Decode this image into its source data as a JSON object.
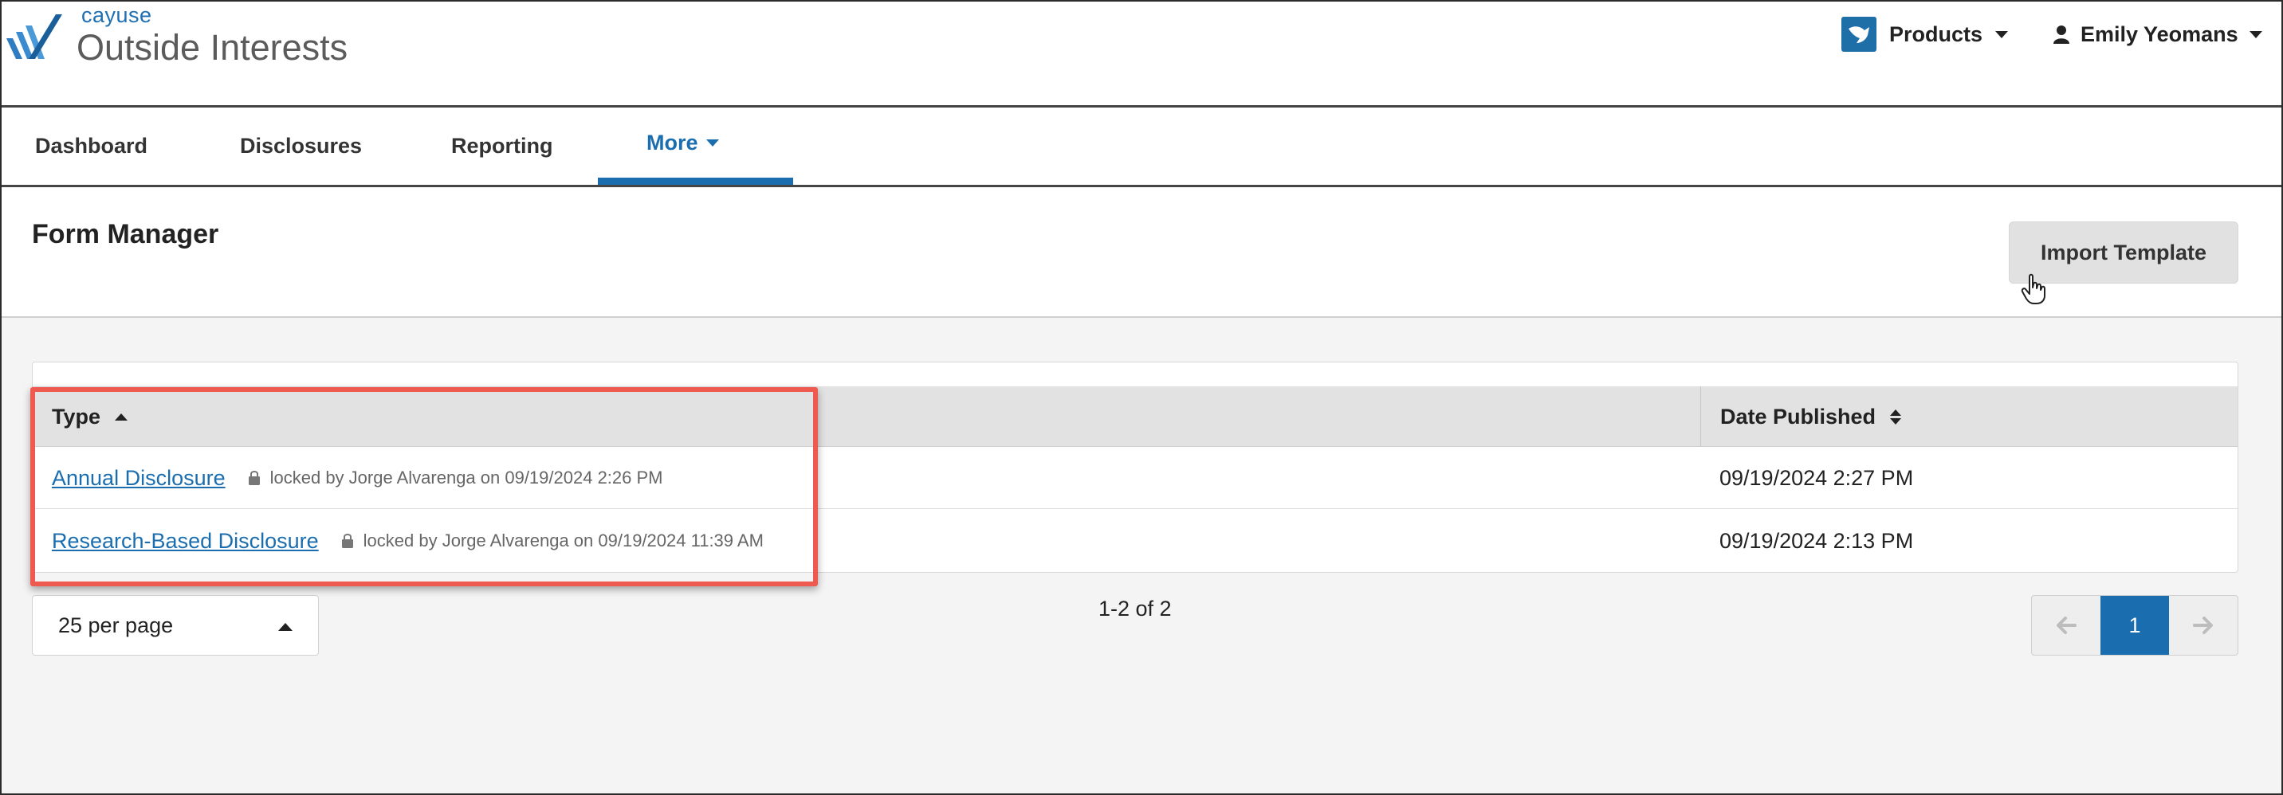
{
  "app": {
    "brand": "cayuse",
    "product_title": "Outside Interests"
  },
  "header": {
    "products_label": "Products",
    "user_name": "Emily Yeomans"
  },
  "nav": {
    "items": [
      {
        "label": "Dashboard"
      },
      {
        "label": "Disclosures"
      },
      {
        "label": "Reporting"
      },
      {
        "label": "More"
      }
    ],
    "active": "More"
  },
  "page": {
    "title": "Form Manager",
    "import_button": "Import Template"
  },
  "table": {
    "columns": {
      "type": "Type",
      "date_published": "Date Published"
    },
    "rows": [
      {
        "type": "Annual Disclosure",
        "lock_note": "locked by Jorge Alvarenga on 09/19/2024 2:26 PM",
        "date_published": "09/19/2024 2:27 PM"
      },
      {
        "type": "Research-Based Disclosure",
        "lock_note": "locked by Jorge Alvarenga on 09/19/2024 11:39 AM",
        "date_published": "09/19/2024 2:13 PM"
      }
    ]
  },
  "pagination": {
    "per_page": "25 per page",
    "range": "1-2 of 2",
    "current_page": "1",
    "prev_icon": "arrow-left-icon",
    "next_icon": "arrow-right-icon"
  },
  "colors": {
    "accent": "#1a6eb0",
    "highlight": "#ee5a4f",
    "background": "#f4f4f4"
  }
}
